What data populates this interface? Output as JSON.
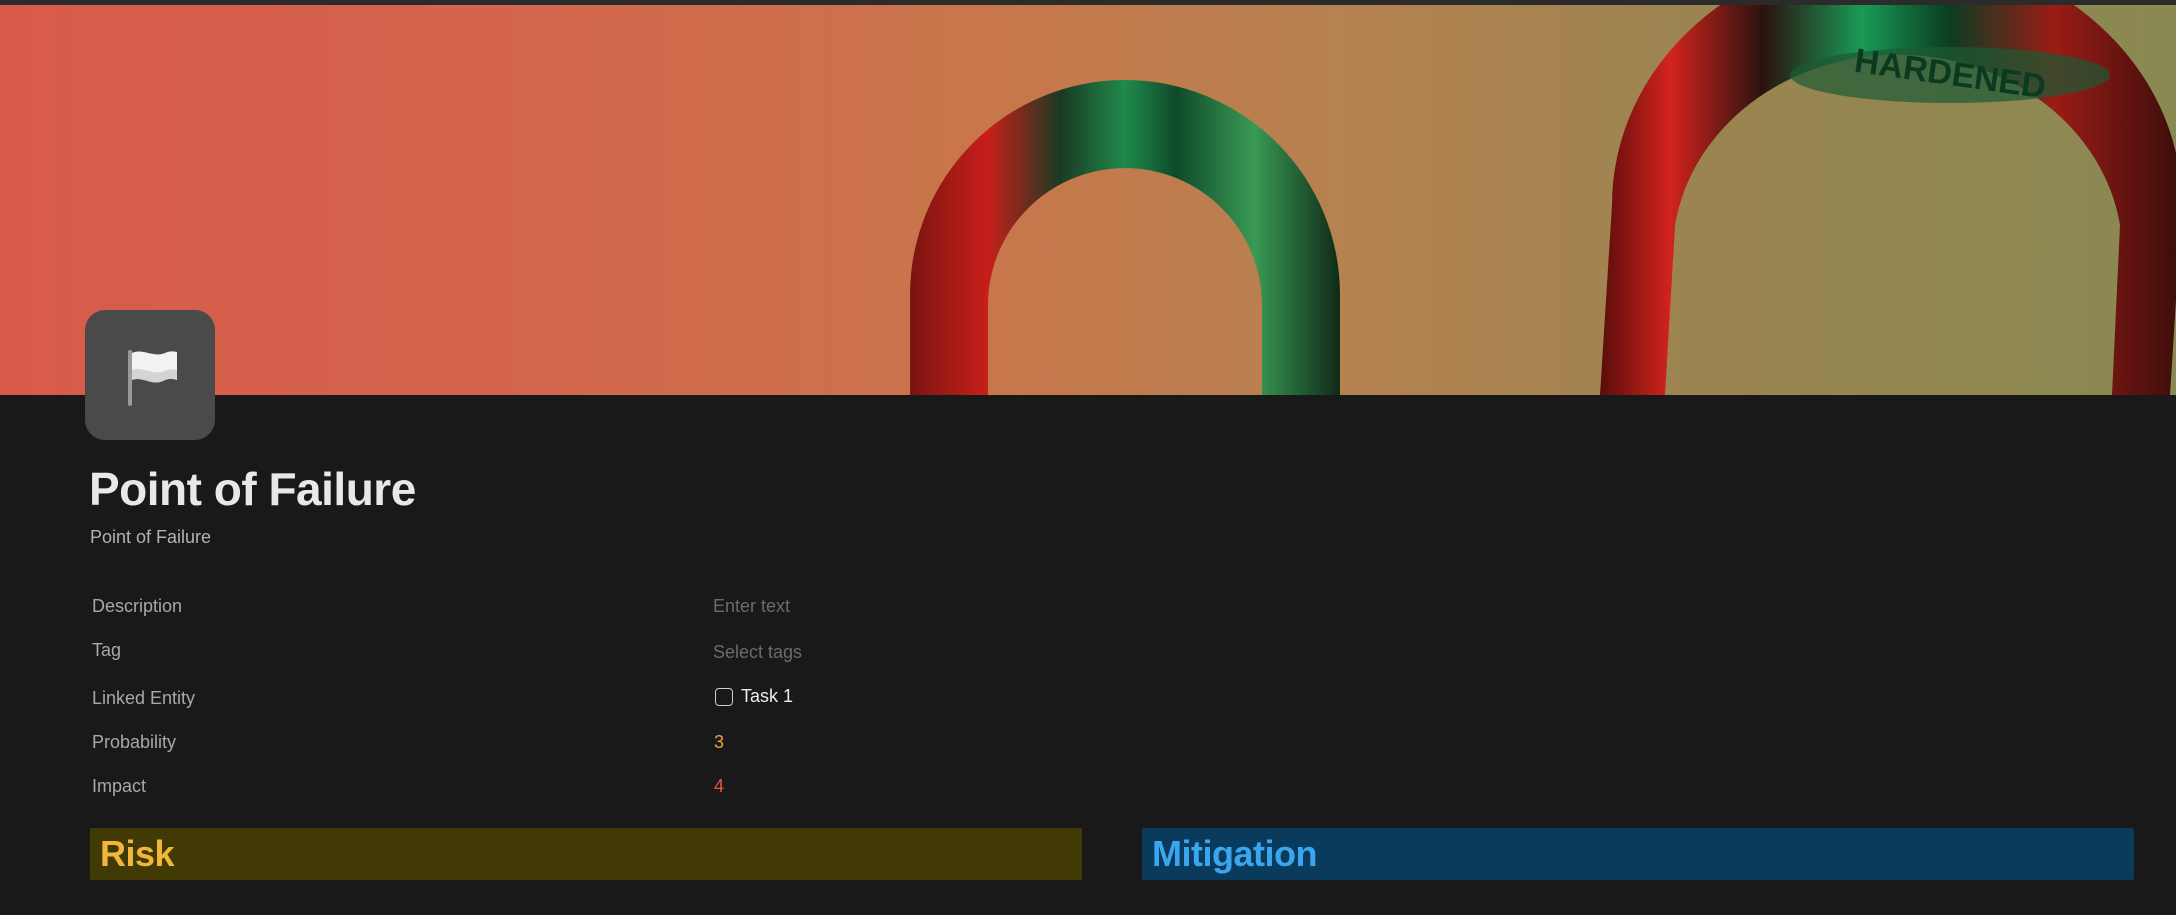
{
  "page": {
    "title": "Point of Failure",
    "subtitle": "Point of Failure",
    "icon": "flag-icon"
  },
  "cover": {
    "engraving": "HARDENED"
  },
  "properties": [
    {
      "label": "Description",
      "value": "Enter text",
      "placeholder": true
    },
    {
      "label": "Tag",
      "value": "Select tags",
      "placeholder": true
    },
    {
      "label": "Linked Entity",
      "value": "Task 1",
      "checkbox": true
    },
    {
      "label": "Probability",
      "value": "3",
      "color": "#f0a43a"
    },
    {
      "label": "Impact",
      "value": "4",
      "color": "#e5574b"
    }
  ],
  "sections": {
    "risk": {
      "label": "Risk",
      "bg": "#413a05",
      "color": "#f2b63a"
    },
    "mitigation": {
      "label": "Mitigation",
      "bg": "#0a3a5c",
      "color": "#3aa6ee"
    }
  }
}
